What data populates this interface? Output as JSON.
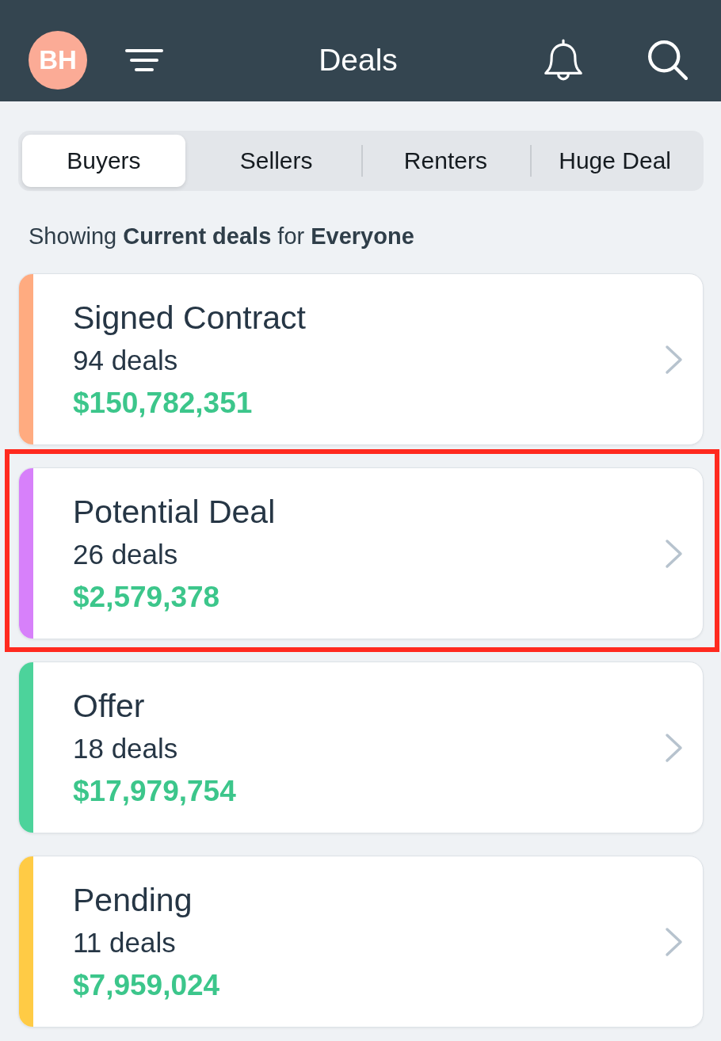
{
  "header": {
    "avatar_initials": "BH",
    "title": "Deals"
  },
  "tabs": [
    {
      "label": "Buyers",
      "selected": true
    },
    {
      "label": "Sellers",
      "selected": false
    },
    {
      "label": "Renters",
      "selected": false
    },
    {
      "label": "Huge Deal",
      "selected": false
    }
  ],
  "filter_summary": "Showing **Current deals** for **Everyone**",
  "stages": [
    {
      "name": "Signed Contract",
      "count": "94 deals",
      "amount": "$150,782,351",
      "color": "#ffab80",
      "highlighted": false
    },
    {
      "name": "Potential Deal",
      "count": "26 deals",
      "amount": "$2,579,378",
      "color": "#d780fa",
      "highlighted": true
    },
    {
      "name": "Offer",
      "count": "18 deals",
      "amount": "$17,979,754",
      "color": "#4cd39b",
      "highlighted": false
    },
    {
      "name": "Pending",
      "count": "11 deals",
      "amount": "$7,959,024",
      "color": "#ffcb45",
      "highlighted": false
    }
  ]
}
